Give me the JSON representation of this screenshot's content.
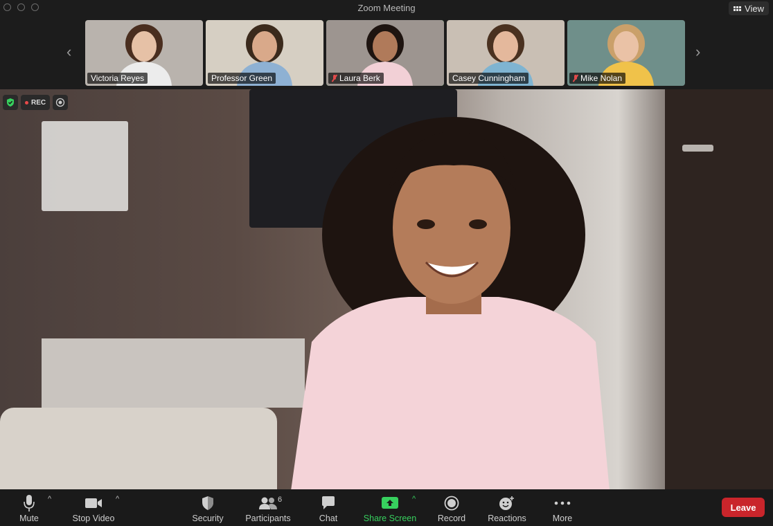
{
  "window": {
    "title": "Zoom Meeting"
  },
  "view_button": {
    "label": "View",
    "icon": "grid-icon"
  },
  "participants_strip": {
    "tiles": [
      {
        "name": "Victoria Reyes",
        "muted": false,
        "active": false,
        "bg": "#b9b3ad",
        "shirt": "#ececec",
        "hair": "#4a2e1f",
        "skin": "#e6c1a6"
      },
      {
        "name": "Professor Green",
        "muted": false,
        "active": false,
        "bg": "#d6cfc3",
        "shirt": "#8eb1d3",
        "hair": "#3b2a1c",
        "skin": "#d9a98a"
      },
      {
        "name": "Laura Berk",
        "muted": true,
        "active": true,
        "bg": "#9d9590",
        "shirt": "#f2d0d6",
        "hair": "#1e1410",
        "skin": "#b07a5a"
      },
      {
        "name": "Casey Cunningham",
        "muted": false,
        "active": false,
        "bg": "#c9bfb4",
        "shirt": "#7fb4d1",
        "hair": "#4a3120",
        "skin": "#e4b89c"
      },
      {
        "name": "Mike Nolan",
        "muted": true,
        "active": false,
        "bg": "#6f8f8a",
        "shirt": "#f0c24a",
        "hair": "#caa06a",
        "skin": "#eac2a6"
      }
    ]
  },
  "status_badges": {
    "rec_label": "REC"
  },
  "toolbar": {
    "mute": "Mute",
    "stop_video": "Stop Video",
    "security": "Security",
    "participants": "Participants",
    "participants_count": "6",
    "chat": "Chat",
    "share_screen": "Share Screen",
    "record": "Record",
    "reactions": "Reactions",
    "more": "More",
    "leave": "Leave"
  },
  "colors": {
    "accent_green": "#37d05e",
    "leave_red": "#c9252b",
    "rec_red": "#e84a4a"
  }
}
